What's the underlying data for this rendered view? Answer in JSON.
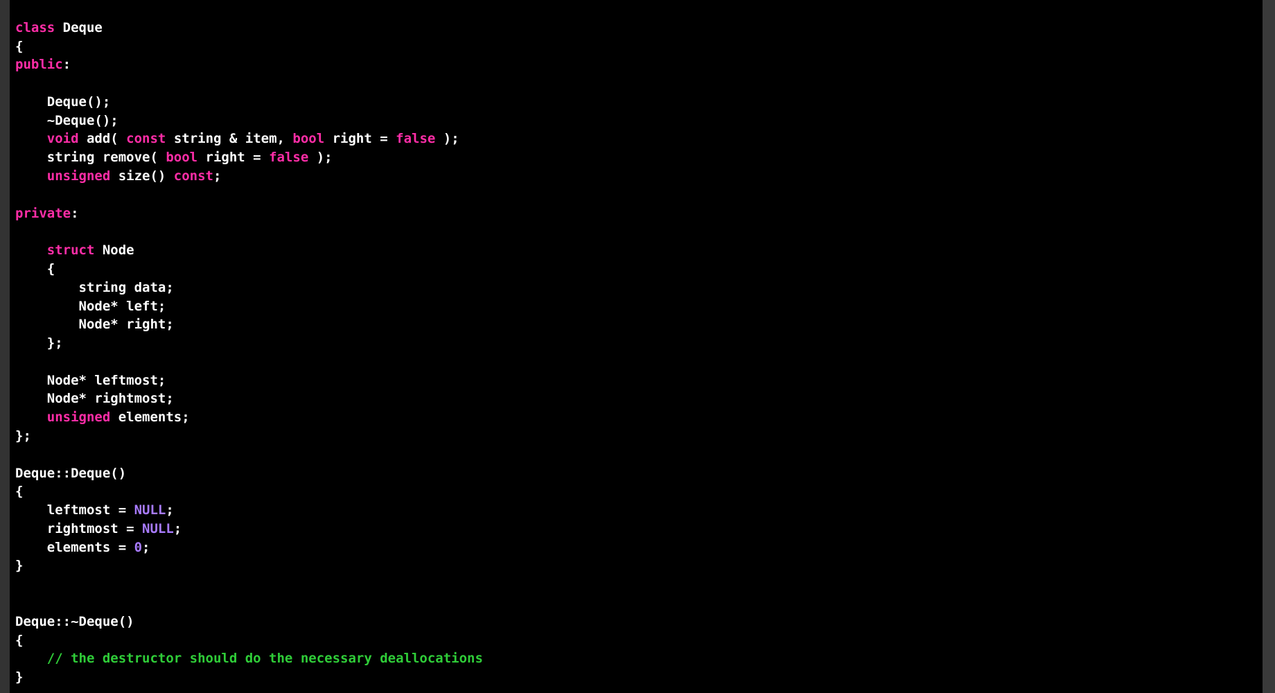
{
  "code": {
    "lines": [
      {
        "tokens": [
          {
            "t": "",
            "c": "white"
          }
        ]
      },
      {
        "tokens": [
          {
            "t": "class",
            "c": "kw"
          },
          {
            "t": " Deque",
            "c": "white"
          }
        ]
      },
      {
        "tokens": [
          {
            "t": "{",
            "c": "white"
          }
        ]
      },
      {
        "tokens": [
          {
            "t": "public",
            "c": "kw"
          },
          {
            "t": ":",
            "c": "white"
          }
        ]
      },
      {
        "tokens": [
          {
            "t": "",
            "c": "white"
          }
        ]
      },
      {
        "tokens": [
          {
            "t": "    Deque();",
            "c": "white"
          }
        ]
      },
      {
        "tokens": [
          {
            "t": "    ~Deque();",
            "c": "white"
          }
        ]
      },
      {
        "tokens": [
          {
            "t": "    ",
            "c": "white"
          },
          {
            "t": "void",
            "c": "kw"
          },
          {
            "t": " add( ",
            "c": "white"
          },
          {
            "t": "const",
            "c": "kw"
          },
          {
            "t": " string & item, ",
            "c": "white"
          },
          {
            "t": "bool",
            "c": "kw"
          },
          {
            "t": " right = ",
            "c": "white"
          },
          {
            "t": "false",
            "c": "bool"
          },
          {
            "t": " );",
            "c": "white"
          }
        ]
      },
      {
        "tokens": [
          {
            "t": "    string remove( ",
            "c": "white"
          },
          {
            "t": "bool",
            "c": "kw"
          },
          {
            "t": " right = ",
            "c": "white"
          },
          {
            "t": "false",
            "c": "bool"
          },
          {
            "t": " );",
            "c": "white"
          }
        ]
      },
      {
        "tokens": [
          {
            "t": "    ",
            "c": "white"
          },
          {
            "t": "unsigned",
            "c": "kw"
          },
          {
            "t": " size() ",
            "c": "white"
          },
          {
            "t": "const",
            "c": "kw"
          },
          {
            "t": ";",
            "c": "white"
          }
        ]
      },
      {
        "tokens": [
          {
            "t": "",
            "c": "white"
          }
        ]
      },
      {
        "tokens": [
          {
            "t": "private",
            "c": "kw"
          },
          {
            "t": ":",
            "c": "white"
          }
        ]
      },
      {
        "tokens": [
          {
            "t": "",
            "c": "white"
          }
        ]
      },
      {
        "tokens": [
          {
            "t": "    ",
            "c": "white"
          },
          {
            "t": "struct",
            "c": "kw"
          },
          {
            "t": " Node",
            "c": "white"
          }
        ]
      },
      {
        "tokens": [
          {
            "t": "    {",
            "c": "white"
          }
        ]
      },
      {
        "tokens": [
          {
            "t": "        string data;",
            "c": "white"
          }
        ]
      },
      {
        "tokens": [
          {
            "t": "        Node* left;",
            "c": "white"
          }
        ]
      },
      {
        "tokens": [
          {
            "t": "        Node* right;",
            "c": "white"
          }
        ]
      },
      {
        "tokens": [
          {
            "t": "    };",
            "c": "white"
          }
        ]
      },
      {
        "tokens": [
          {
            "t": "",
            "c": "white"
          }
        ]
      },
      {
        "tokens": [
          {
            "t": "    Node* leftmost;",
            "c": "white"
          }
        ]
      },
      {
        "tokens": [
          {
            "t": "    Node* rightmost;",
            "c": "white"
          }
        ]
      },
      {
        "tokens": [
          {
            "t": "    ",
            "c": "white"
          },
          {
            "t": "unsigned",
            "c": "kw"
          },
          {
            "t": " elements;",
            "c": "white"
          }
        ]
      },
      {
        "tokens": [
          {
            "t": "};",
            "c": "white"
          }
        ]
      },
      {
        "tokens": [
          {
            "t": "",
            "c": "white"
          }
        ]
      },
      {
        "tokens": [
          {
            "t": "Deque::Deque()",
            "c": "white"
          }
        ]
      },
      {
        "tokens": [
          {
            "t": "{",
            "c": "white"
          }
        ]
      },
      {
        "tokens": [
          {
            "t": "    leftmost = ",
            "c": "white"
          },
          {
            "t": "NULL",
            "c": "null"
          },
          {
            "t": ";",
            "c": "white"
          }
        ]
      },
      {
        "tokens": [
          {
            "t": "    rightmost = ",
            "c": "white"
          },
          {
            "t": "NULL",
            "c": "null"
          },
          {
            "t": ";",
            "c": "white"
          }
        ]
      },
      {
        "tokens": [
          {
            "t": "    elements = ",
            "c": "white"
          },
          {
            "t": "0",
            "c": "null"
          },
          {
            "t": ";",
            "c": "white"
          }
        ]
      },
      {
        "tokens": [
          {
            "t": "}",
            "c": "white"
          }
        ]
      },
      {
        "tokens": [
          {
            "t": "",
            "c": "white"
          }
        ]
      },
      {
        "tokens": [
          {
            "t": "",
            "c": "white"
          }
        ]
      },
      {
        "tokens": [
          {
            "t": "Deque::~Deque()",
            "c": "white"
          }
        ]
      },
      {
        "tokens": [
          {
            "t": "{",
            "c": "white"
          }
        ]
      },
      {
        "tokens": [
          {
            "t": "    ",
            "c": "white"
          },
          {
            "t": "// the destructor should do the necessary deallocations",
            "c": "comment"
          }
        ]
      },
      {
        "tokens": [
          {
            "t": "}",
            "c": "white"
          }
        ]
      }
    ]
  }
}
